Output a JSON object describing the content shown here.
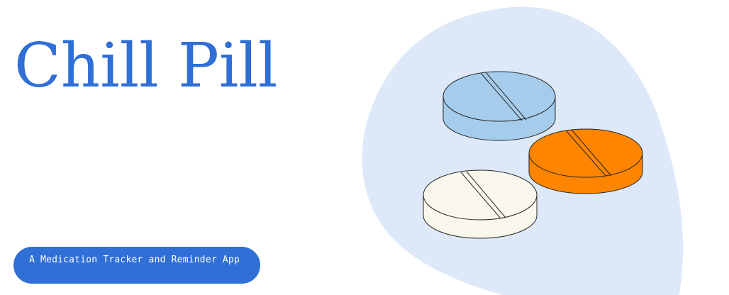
{
  "hero": {
    "title": "Chill Pill",
    "tagline": "A Medication Tracker and Reminder App"
  },
  "colors": {
    "brand": "#2f6fd6",
    "blob": "#dde8f9",
    "pill_blue": "#a5cdeb",
    "pill_orange": "#ff8400",
    "pill_cream": "#f9f7ec",
    "outline": "#262626"
  },
  "illustration": {
    "icons": [
      "blob-shape",
      "blue-pill-icon",
      "orange-pill-icon",
      "cream-pill-icon"
    ]
  }
}
